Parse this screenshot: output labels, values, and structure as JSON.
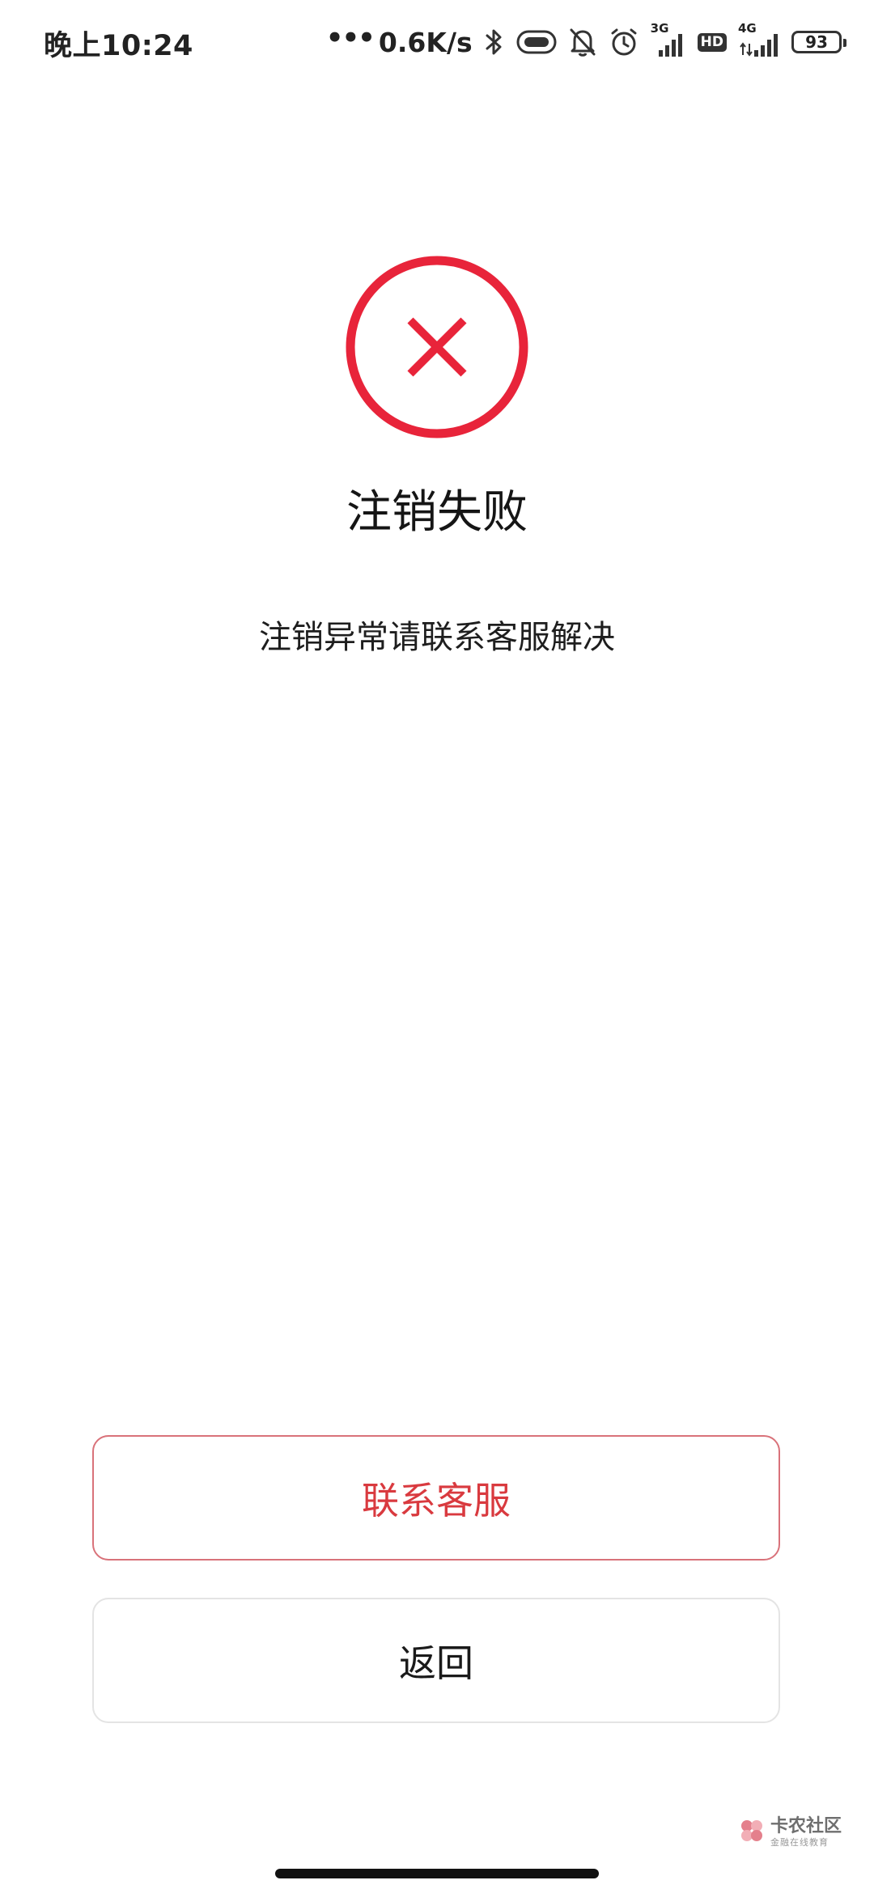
{
  "status_bar": {
    "time": "晚上10:24",
    "dots": "•••",
    "net_speed": "0.6K/s",
    "sim1_label": "3G",
    "hd_label": "HD",
    "sim2_label": "4G",
    "battery": "93"
  },
  "result": {
    "status": "failed",
    "icon": "close-circle-icon",
    "title": "注销失败",
    "message": "注销异常请联系客服解决"
  },
  "buttons": {
    "contact_label": "联系客服",
    "back_label": "返回"
  },
  "watermark": {
    "title": "卡农社区",
    "subtitle": "金融在线教育"
  },
  "colors": {
    "accent": "#E8243A",
    "contact_text": "#D93A3F",
    "contact_border": "#D9727A",
    "back_border": "#E4E4E4"
  }
}
